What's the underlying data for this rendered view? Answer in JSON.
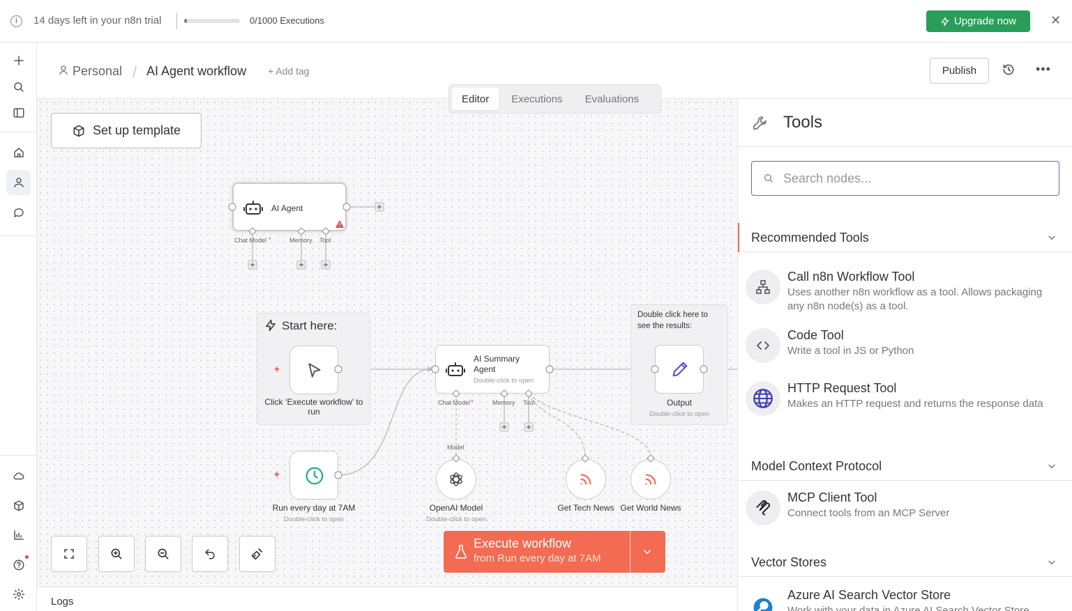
{
  "banner": {
    "trial_text": "14 days left in your n8n trial",
    "executions_text": "0/1000 Executions",
    "executions_progress": 0.05,
    "upgrade_label": "Upgrade now",
    "accent_color": "#2a9d5a"
  },
  "sidebar": {
    "items": [
      "plus-icon",
      "search-icon",
      "panel-icon",
      "home-icon",
      "user-icon",
      "chat-icon",
      "cloud-icon",
      "box-icon",
      "chart-icon",
      "help-icon",
      "gear-icon"
    ]
  },
  "header": {
    "project": "Personal",
    "separator": "/",
    "workflow_name": "AI Agent workflow",
    "add_tag": "+ Add tag",
    "publish_label": "Publish"
  },
  "tabs": [
    {
      "label": "Editor",
      "active": true
    },
    {
      "label": "Executions",
      "active": false
    },
    {
      "label": "Evaluations",
      "active": false
    }
  ],
  "canvas": {
    "setup_template_label": "Set up template",
    "start_here": "Start here:",
    "sticky_note": "Double click here to see the results:",
    "nodes": {
      "ai_agent": {
        "label": "AI Agent",
        "handles": [
          "Chat Model",
          "Memory",
          "Tool"
        ]
      },
      "trigger_click": {
        "label": "Click ‘Execute workflow’ to run"
      },
      "summary_agent": {
        "label": "AI Summary Agent",
        "sub": "Double-click to open",
        "handles": [
          "Chat Model",
          "Memory",
          "Tool"
        ]
      },
      "output": {
        "label": "Output",
        "sub": "Double-click to open"
      },
      "schedule": {
        "label": "Run every day at 7AM",
        "sub": "Double-click to open"
      },
      "openai": {
        "label": "OpenAI Model",
        "sub": "Double-click to open",
        "edge_label": "Model"
      },
      "tech_news": {
        "label": "Get Tech News"
      },
      "world_news": {
        "label": "Get World News"
      }
    },
    "execute": {
      "label": "Execute workflow",
      "sub": "from Run every day at 7AM",
      "color": "#f26b52"
    }
  },
  "logs": {
    "label": "Logs"
  },
  "panel": {
    "title": "Tools",
    "search_placeholder": "Search nodes...",
    "sections": [
      {
        "label": "Recommended Tools",
        "items": [
          {
            "name": "Call n8n Workflow Tool",
            "desc": "Uses another n8n workflow as a tool. Allows packaging any n8n node(s) as a tool.",
            "icon": "sitemap-icon"
          },
          {
            "name": "Code Tool",
            "desc": "Write a tool in JS or Python",
            "icon": "code-icon"
          },
          {
            "name": "HTTP Request Tool",
            "desc": "Makes an HTTP request and returns the response data",
            "icon": "globe-icon"
          }
        ]
      },
      {
        "label": "Model Context Protocol",
        "items": [
          {
            "name": "MCP Client Tool",
            "desc": "Connect tools from an MCP Server",
            "icon": "mcp-icon"
          }
        ]
      },
      {
        "label": "Vector Stores",
        "items": [
          {
            "name": "Azure AI Search Vector Store",
            "desc": "Work with your data in Azure AI Search Vector Store",
            "icon": "azure-search-icon"
          }
        ]
      }
    ]
  }
}
